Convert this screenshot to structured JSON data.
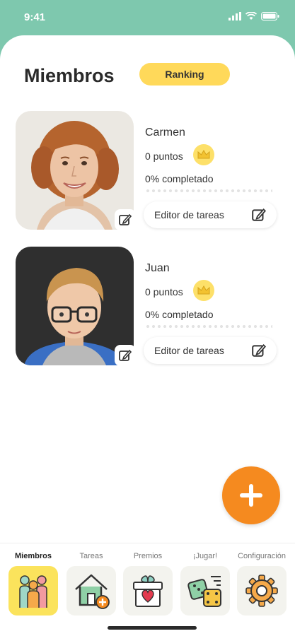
{
  "status": {
    "time": "9:41"
  },
  "header": {
    "title": "Miembros",
    "ranking_label": "Ranking"
  },
  "members": [
    {
      "name": "Carmen",
      "points": "0 puntos",
      "completed": "0% completado",
      "progress": 0,
      "editor_label": "Editor de tareas"
    },
    {
      "name": "Juan",
      "points": "0 puntos",
      "completed": "0% completado",
      "progress": 0,
      "editor_label": "Editor de tareas"
    }
  ],
  "tabs": [
    {
      "label": "Miembros",
      "icon": "family-icon",
      "active": true
    },
    {
      "label": "Tareas",
      "icon": "house-add-icon",
      "active": false
    },
    {
      "label": "Premios",
      "icon": "gift-heart-icon",
      "active": false
    },
    {
      "label": "¡Jugar!",
      "icon": "dice-icon",
      "active": false
    },
    {
      "label": "Configuración",
      "icon": "gear-icon",
      "active": false
    }
  ],
  "colors": {
    "header": "#7ec8ae",
    "ranking": "#ffd95a",
    "fab": "#f58a1f",
    "active_tab": "#fbe35c"
  }
}
